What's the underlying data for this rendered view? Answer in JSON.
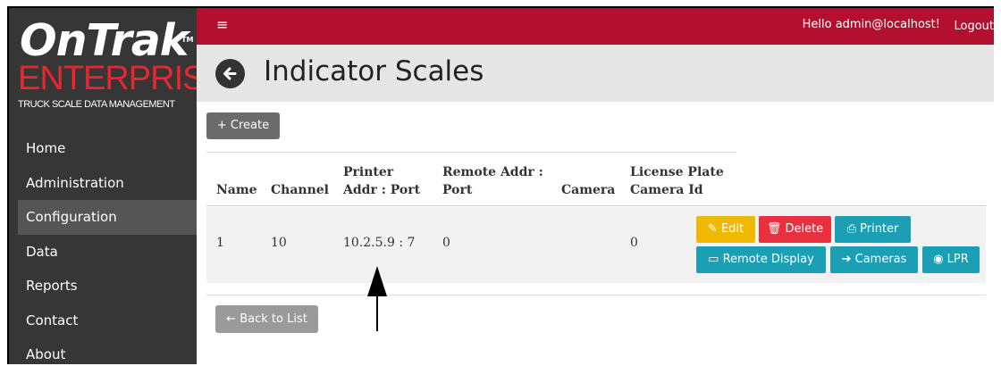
{
  "logo": {
    "main": "OnTrak",
    "tm": "TM",
    "sub": "ENTERPRISE",
    "tagline": "TRUCK SCALE DATA MANAGEMENT"
  },
  "sidebar": {
    "items": [
      {
        "label": "Home"
      },
      {
        "label": "Administration"
      },
      {
        "label": "Configuration",
        "active": true
      },
      {
        "label": "Data"
      },
      {
        "label": "Reports"
      },
      {
        "label": "Contact"
      },
      {
        "label": "About"
      }
    ]
  },
  "topbar": {
    "menu_icon": "≡",
    "greeting": "Hello admin@localhost!",
    "logout": "Logout"
  },
  "page": {
    "title": "Indicator Scales",
    "create_label": "+ Create",
    "back_to_list_label": "← Back to List"
  },
  "table": {
    "headers": {
      "name": "Name",
      "channel": "Channel",
      "printer_1": "Printer",
      "printer_2": "Addr : Port",
      "remote_1": "Remote Addr :",
      "remote_2": "Port",
      "camera": "Camera",
      "lpr_1": "License Plate",
      "lpr_2": "Camera Id"
    },
    "rows": [
      {
        "name": "1",
        "channel": "10",
        "printer": "10.2.5.9 : 7",
        "remote": "0",
        "camera": "",
        "lpr_camera": "0",
        "actions": {
          "edit": "Edit",
          "delete": "Delete",
          "printer": "Printer",
          "remote_display": "Remote Display",
          "cameras": "Cameras",
          "lpr": "LPR"
        }
      }
    ]
  },
  "colors": {
    "topbar": "#b3102f",
    "sidebar": "#363636",
    "edit": "#f0b800",
    "delete": "#e8313e",
    "info": "#1b9fb5"
  }
}
